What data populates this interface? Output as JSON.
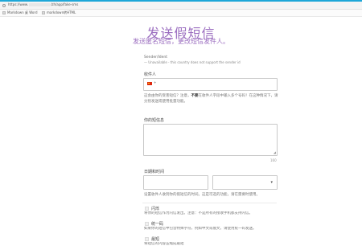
{
  "browser": {
    "url_prefix": "https://www.",
    "url_suffix": "/zh/app/fake-sms",
    "bookmarks": [
      {
        "label": "Markdown 桌 Word"
      },
      {
        "label": "markdown转HTML"
      }
    ]
  },
  "page": {
    "title": "发送假短信",
    "subtitle": "发送匿名短信，更改短信发件人。"
  },
  "form": {
    "sender_label": "Sender/Ident",
    "sender_note": "— Unavailable - this country does not support the sender id",
    "recipient_label": "收件人",
    "recipient_country_code": "+",
    "recipient_help_1": "这会由你的受害短信？注意，",
    "recipient_help_bold": "不要",
    "recipient_help_2": "在收件人字段中输入多个号码！在这种情况下，请分别发送或使用批量功能。",
    "message_label": "你的短信息",
    "char_counter": "160",
    "schedule_label": "日期和时间",
    "schedule_help": "设置收件人收到你的假短信的时间。这是可选的功能，请在需要时使用。",
    "options": [
      {
        "title": "闪烁",
        "desc": "将你的短信作为闪信发出。注意：不是所有的接收手机都支持闪信。"
      },
      {
        "title": "统一码",
        "desc": "如果你的短信中包含特殊字符，例如中文或俄文，请使用统一码发送。"
      },
      {
        "title": "最短",
        "desc": "将短信的内容压缩成最短"
      }
    ]
  }
}
